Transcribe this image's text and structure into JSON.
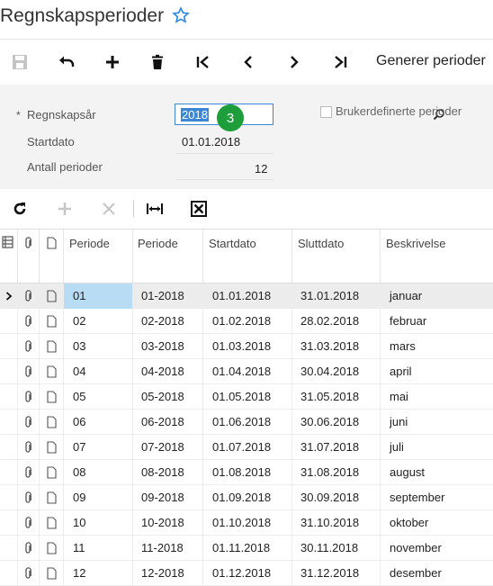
{
  "header": {
    "title": "Regnskapsperioder"
  },
  "toolbar": {
    "generate_label": "Generer perioder"
  },
  "form": {
    "year_label": "Regnskapsår",
    "required_mark": "*",
    "year_value": "2018",
    "badge": "3",
    "start_label": "Startdato",
    "start_value": "01.01.2018",
    "count_label": "Antall perioder",
    "count_value": "12",
    "custom_label": "Brukerdefinerte perioder"
  },
  "grid": {
    "columns": [
      "Periode",
      "Periode",
      "Startdato",
      "Sluttdato",
      "Beskrivelse"
    ],
    "rows": [
      {
        "no": "01",
        "period": "01-2018",
        "start": "01.01.2018",
        "end": "31.01.2018",
        "desc": "januar"
      },
      {
        "no": "02",
        "period": "02-2018",
        "start": "01.02.2018",
        "end": "28.02.2018",
        "desc": "februar"
      },
      {
        "no": "03",
        "period": "03-2018",
        "start": "01.03.2018",
        "end": "31.03.2018",
        "desc": "mars"
      },
      {
        "no": "04",
        "period": "04-2018",
        "start": "01.04.2018",
        "end": "30.04.2018",
        "desc": "april"
      },
      {
        "no": "05",
        "period": "05-2018",
        "start": "01.05.2018",
        "end": "31.05.2018",
        "desc": "mai"
      },
      {
        "no": "06",
        "period": "06-2018",
        "start": "01.06.2018",
        "end": "30.06.2018",
        "desc": "juni"
      },
      {
        "no": "07",
        "period": "07-2018",
        "start": "01.07.2018",
        "end": "31.07.2018",
        "desc": "juli"
      },
      {
        "no": "08",
        "period": "08-2018",
        "start": "01.08.2018",
        "end": "31.08.2018",
        "desc": "august"
      },
      {
        "no": "09",
        "period": "09-2018",
        "start": "01.09.2018",
        "end": "30.09.2018",
        "desc": "september"
      },
      {
        "no": "10",
        "period": "10-2018",
        "start": "01.10.2018",
        "end": "31.10.2018",
        "desc": "oktober"
      },
      {
        "no": "11",
        "period": "11-2018",
        "start": "01.11.2018",
        "end": "30.11.2018",
        "desc": "november"
      },
      {
        "no": "12",
        "period": "12-2018",
        "start": "01.12.2018",
        "end": "31.12.2018",
        "desc": "desember"
      }
    ]
  }
}
